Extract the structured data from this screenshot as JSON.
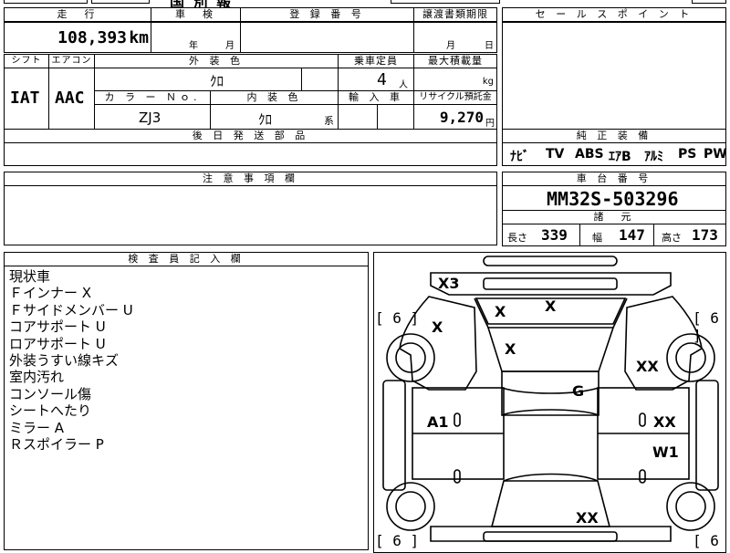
{
  "top_cut": {
    "center_text": "国 別 報"
  },
  "mileage": {
    "header": "走　行",
    "value": "108,393",
    "unit": "km"
  },
  "inspection": {
    "header": "車　検",
    "year_label": "年",
    "month_label": "月"
  },
  "registration": {
    "header": "登 録 番 号"
  },
  "transfer": {
    "header": "譲渡書類期限",
    "month_label": "月",
    "day_label": "日"
  },
  "sales_point": {
    "header": "セ ー ル ス ポ イ ン ト"
  },
  "shift": {
    "header": "シフト",
    "value": "IAT"
  },
  "aircon": {
    "header": "エアコン",
    "value": "AAC"
  },
  "exterior_color": {
    "header": "外 装 色",
    "value": "ｸﾛ"
  },
  "capacity": {
    "header": "乗車定員",
    "value": "4",
    "unit": "人"
  },
  "max_load": {
    "header": "最大積載量",
    "unit": "kg"
  },
  "color_no": {
    "header": "カ ラ ー Ｎｏ.",
    "value": "ZJ3"
  },
  "interior_color": {
    "header": "内 装 色",
    "value": "ｸﾛ",
    "suffix": "系"
  },
  "import": {
    "header": "輸 入 車"
  },
  "recycle": {
    "header": "リサイクル預託金",
    "value": "9,270",
    "unit": "円"
  },
  "later_parts": {
    "header": "後 日 発 送 部 品"
  },
  "equipment": {
    "header": "純 正 装 備",
    "items": [
      "ﾅﾋﾞ",
      "TV",
      "ABS",
      "ｴｱB",
      "ｱﾙﾐ",
      "PS",
      "PW"
    ]
  },
  "caution": {
    "header": "注 意 事 項 欄"
  },
  "chassis": {
    "header": "車 台 番 号",
    "value": "MM32S-503296"
  },
  "specs": {
    "header": "諸　元",
    "length_label": "長さ",
    "length": "339",
    "width_label": "幅",
    "width": "147",
    "height_label": "高さ",
    "height": "173"
  },
  "inspector": {
    "header": "検 査 員 記 入 欄",
    "notes": [
      "現状車",
      "Ｆインナー X",
      "Ｆサイドメンバー U",
      "コアサポート U",
      "ロアサポート U",
      "外装うすい線キズ",
      "室内汚れ",
      "コンソール傷",
      "シートへたり",
      "ミラー A",
      "Ｒスポイラー P"
    ]
  },
  "diagram": {
    "marks": {
      "x3": "X3",
      "front_left_fender": "X",
      "roof_front_left": "X",
      "roof_front_right": "X",
      "hood": "X",
      "right_front_fender": "XX",
      "roof": "G",
      "left_front_door": "A1",
      "right_front_door": "XX",
      "right_rear_door": "W1",
      "rear": "XX"
    },
    "tires": [
      "[ 6 ]",
      "[ 6 ]",
      "[ 6 ]",
      "[ 6 ]"
    ]
  }
}
